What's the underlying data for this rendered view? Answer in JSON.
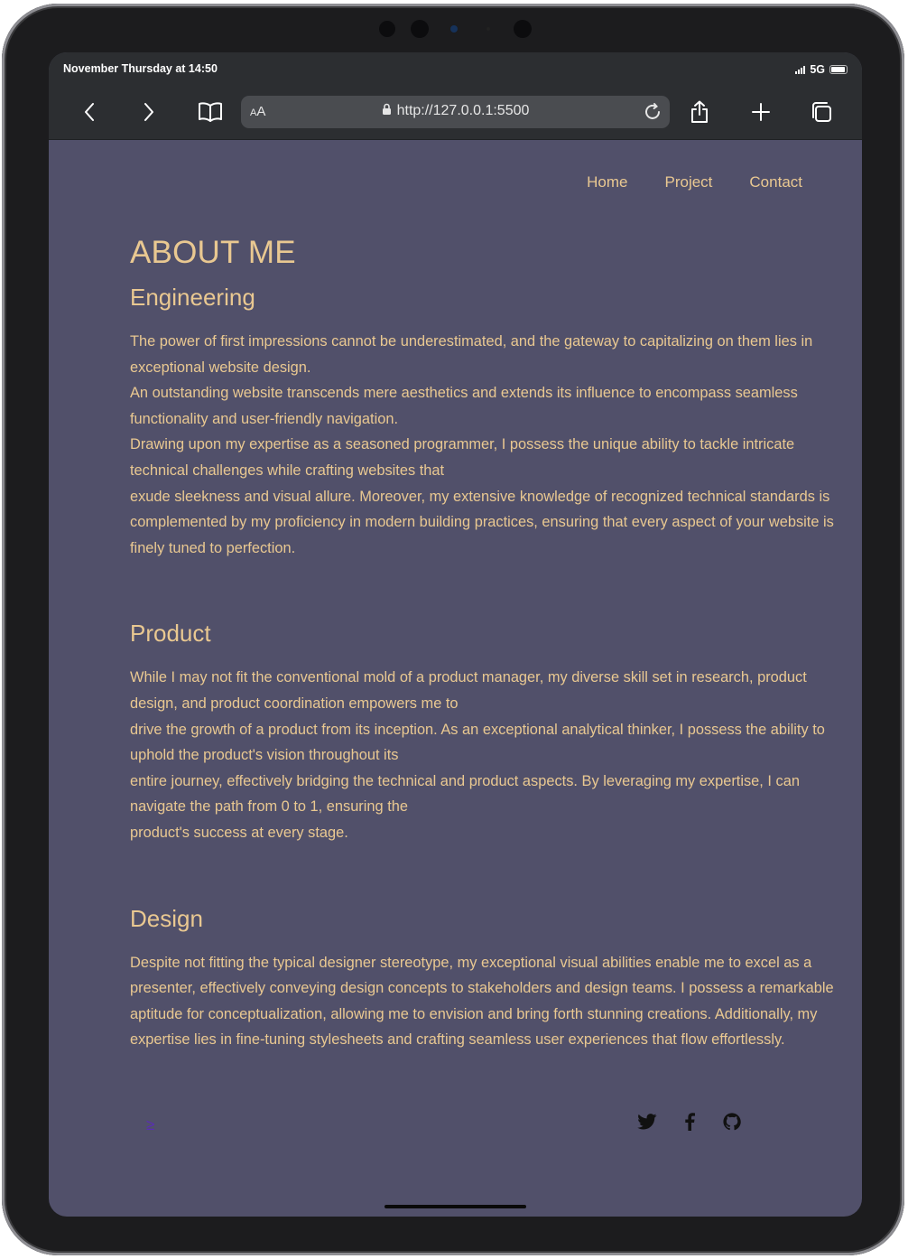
{
  "status_bar": {
    "time": "November Thursday at 14:50",
    "network": "5G"
  },
  "browser": {
    "text_size_label_small": "A",
    "text_size_label_large": "A",
    "url": "http://127.0.0.1:5500"
  },
  "nav": {
    "items": [
      "Home",
      "Project",
      "Contact"
    ]
  },
  "main": {
    "title": "ABOUT ME",
    "sections": [
      {
        "heading": "Engineering",
        "lines": [
          "The power of first impressions cannot be underestimated, and the gateway to capitalizing on them lies in exceptional website design.",
          "An outstanding website transcends mere aesthetics and extends its influence to encompass seamless functionality and user-friendly navigation.",
          "Drawing upon my expertise as a seasoned programmer, I possess the unique ability to tackle intricate technical challenges while crafting websites that",
          "exude sleekness and visual allure. Moreover, my extensive knowledge of recognized technical standards is complemented by my proficiency in modern building practices, ensuring that every aspect of your website is finely tuned to perfection."
        ]
      },
      {
        "heading": "Product",
        "lines": [
          "While I may not fit the conventional mold of a product manager, my diverse skill set in research, product design, and product coordination empowers me to",
          "drive the growth of a product from its inception. As an exceptional analytical thinker, I possess the ability to uphold the product's vision throughout its",
          "entire journey, effectively bridging the technical and product aspects. By leveraging my expertise, I can navigate the path from 0 to 1, ensuring the",
          "product's success at every stage."
        ]
      },
      {
        "heading": "Design",
        "lines": [
          "Despite not fitting the typical designer stereotype, my exceptional visual abilities enable me to excel as a presenter, effectively conveying design concepts to stakeholders and design teams. I possess a remarkable aptitude for conceptualization, allowing me to envision and bring forth stunning creations. Additionally, my expertise lies in fine-tuning stylesheets and crafting seamless user experiences that flow effortlessly."
        ]
      }
    ]
  },
  "footer": {
    "mark": "≥",
    "social_icons": [
      "twitter-icon",
      "facebook-icon",
      "github-icon"
    ]
  },
  "colors": {
    "page_background": "#51506a",
    "text_accent": "#e9c891",
    "browser_chrome": "#2c2e31",
    "footer_mark": "#5a2db5"
  }
}
